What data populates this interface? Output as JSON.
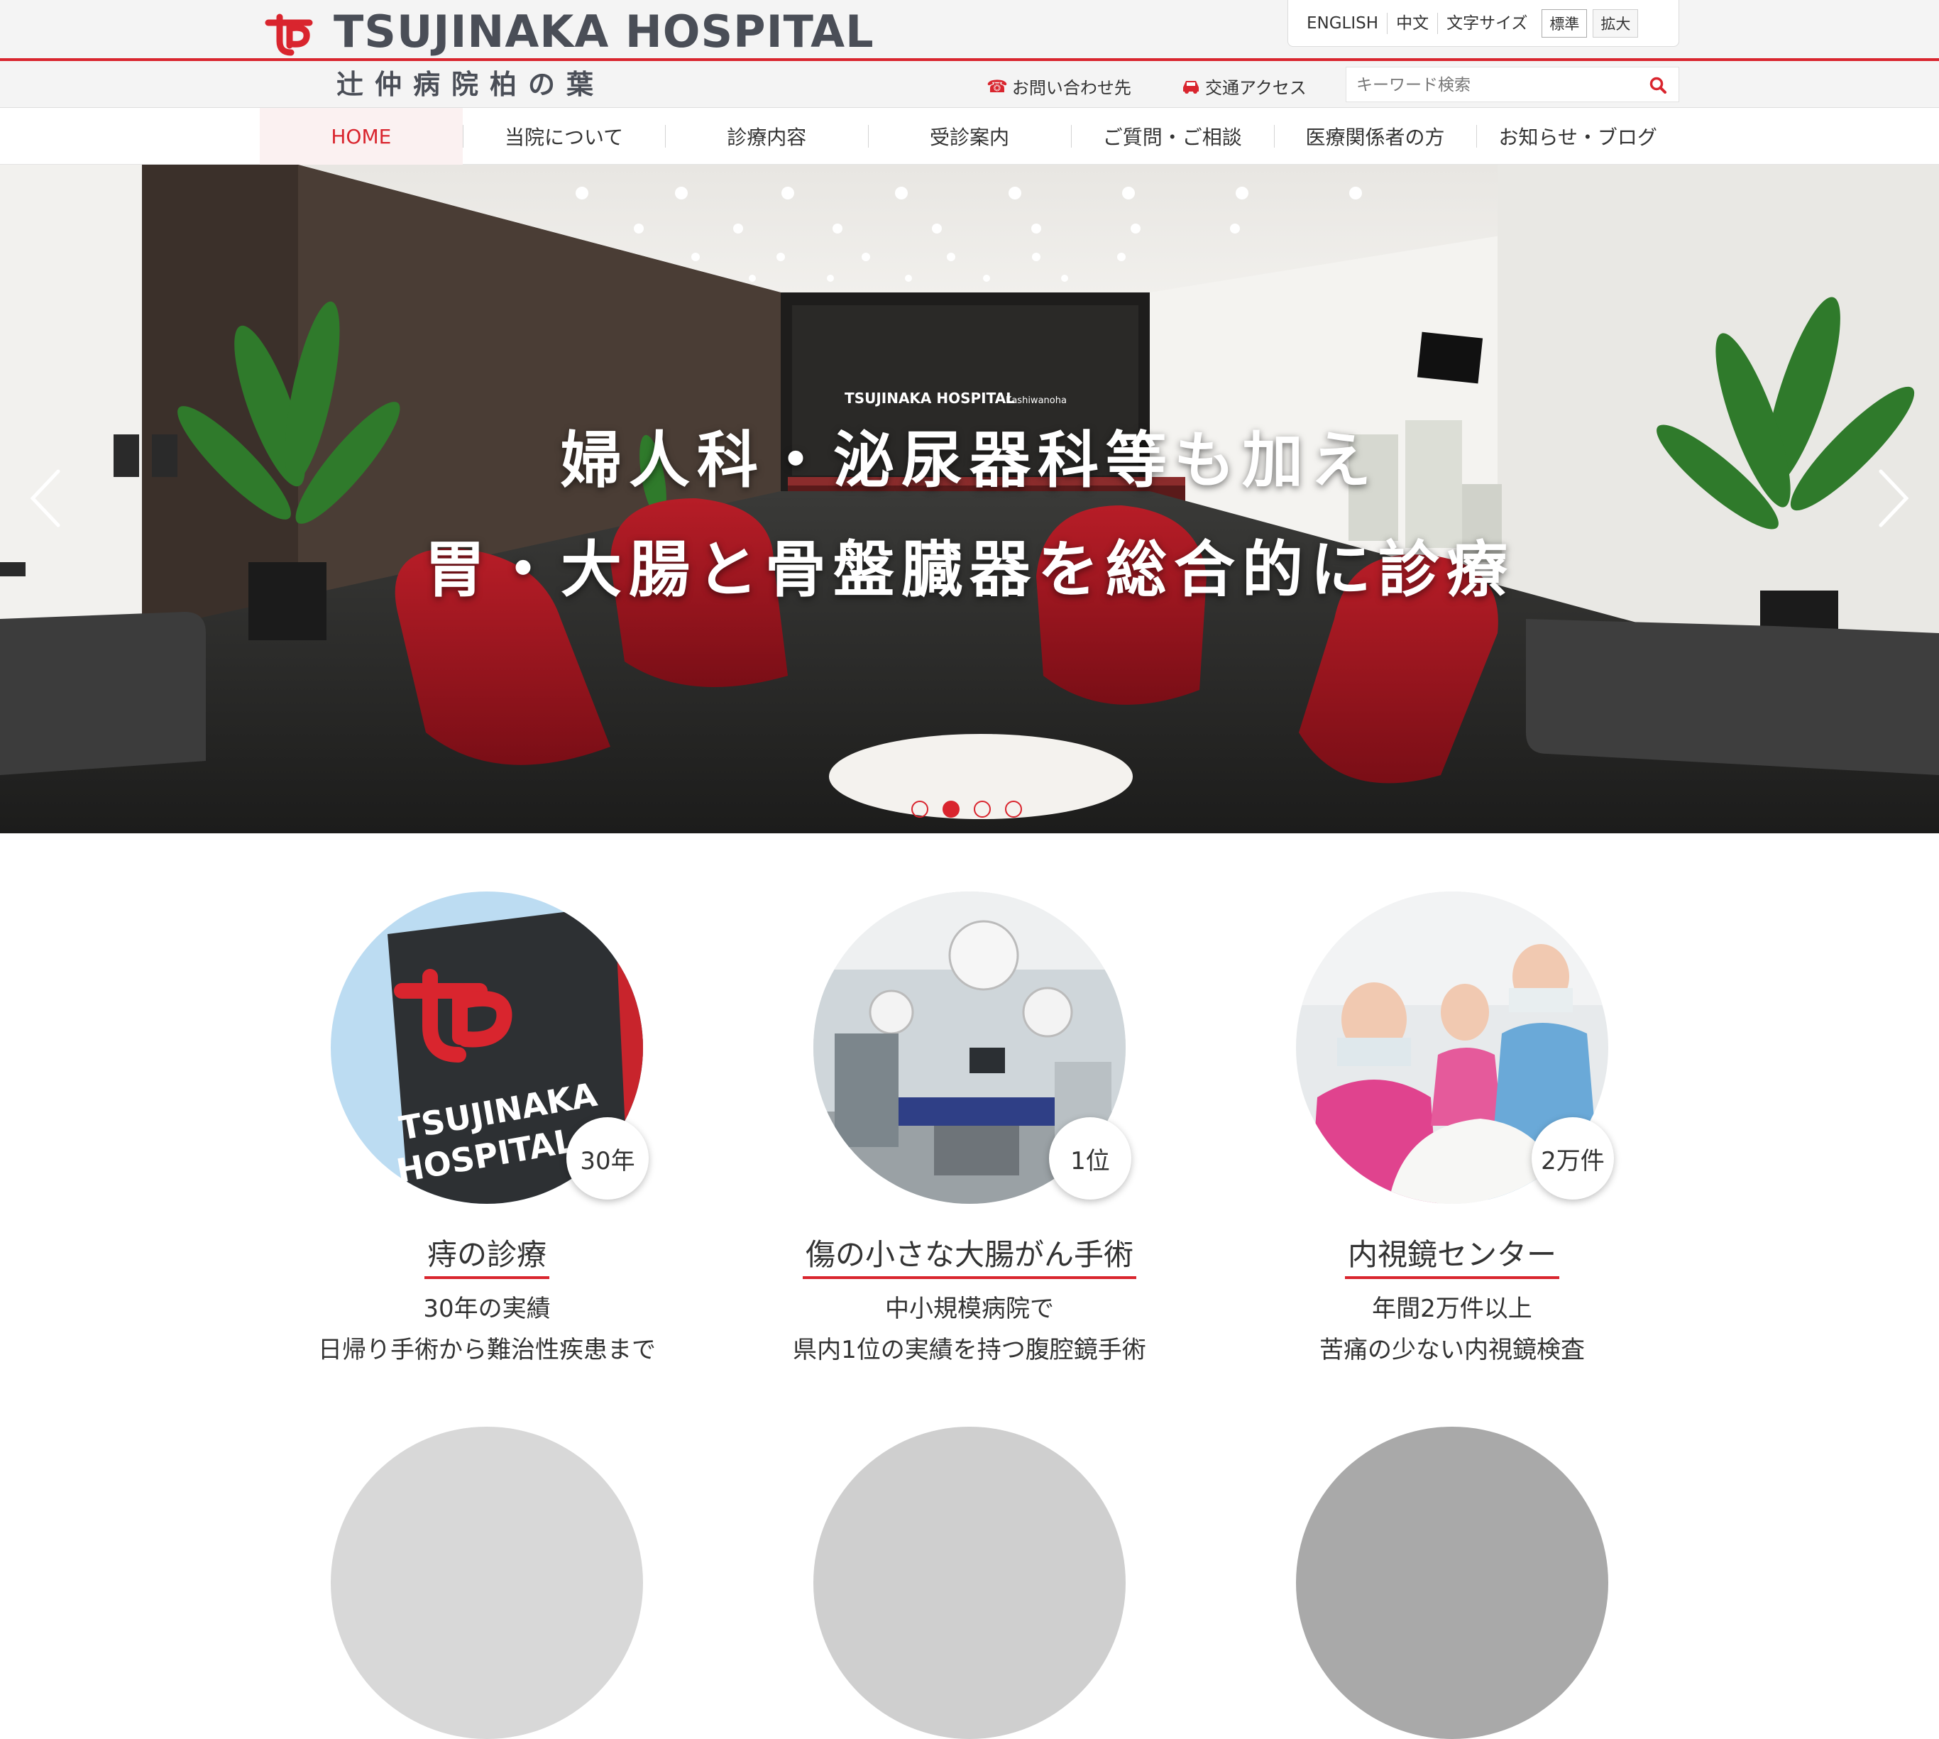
{
  "header": {
    "logo_en": "TSUJINAKA HOSPITAL",
    "logo_jp": "辻仲病院柏の葉",
    "utility": {
      "english": "ENGLISH",
      "chinese": "中文",
      "font_size_label": "文字サイズ",
      "size_normal": "標準",
      "size_large": "拡大"
    },
    "contact": "お問い合わせ先",
    "access": "交通アクセス",
    "search_placeholder": "キーワード検索"
  },
  "nav": {
    "items": [
      "HOME",
      "当院について",
      "診療内容",
      "受診案内",
      "ご質問・ご相談",
      "医療関係者の方",
      "お知らせ・ブログ"
    ],
    "active_index": 0
  },
  "hero": {
    "line1": "婦人科・泌尿器科等も加え",
    "line2": "胃・大腸と骨盤臓器を総合的に診療",
    "sign": "TSUJINAKA HOSPITAL",
    "sign_small": "Kashiwanoha",
    "slide_count": 4,
    "active_slide": 1
  },
  "features": [
    {
      "badge": "30年",
      "title": "痔の診療",
      "line1": "30年の実績",
      "line2": "日帰り手術から難治性疾患まで",
      "image_text_1": "TSUJINAKA",
      "image_text_2": "HOSPITAL"
    },
    {
      "badge": "1位",
      "title": "傷の小さな大腸がん手術",
      "line1": "中小規模病院で",
      "line2": "県内1位の実績を持つ腹腔鏡手術"
    },
    {
      "badge": "2万件",
      "title": "内視鏡センター",
      "line1": "年間2万件以上",
      "line2": "苦痛の少ない内視鏡検査"
    }
  ],
  "colors": {
    "accent": "#d9252e",
    "text": "#333333",
    "logo_gray": "#4a4e57"
  }
}
